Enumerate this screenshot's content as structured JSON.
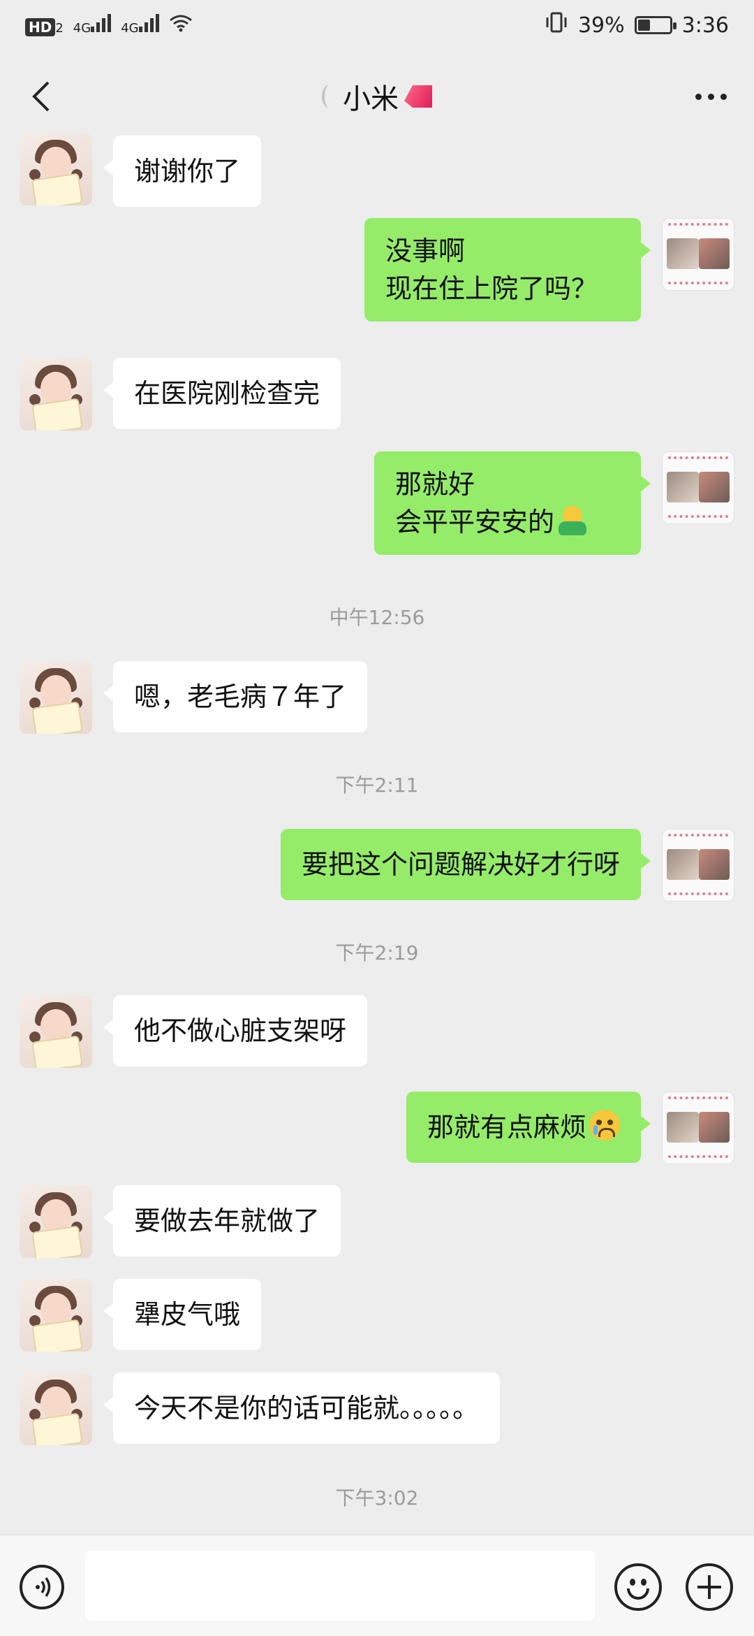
{
  "status_bar": {
    "hd": "HD",
    "hd_sub": "2",
    "net1": "4G",
    "net2": "4G",
    "battery_percent": "39%",
    "battery_level": 0.39,
    "time": "3:36",
    "icons": [
      "hd-icon",
      "signal-icon",
      "signal-icon",
      "wifi-icon",
      "vibrate-icon",
      "battery-icon"
    ]
  },
  "header": {
    "title": "小米",
    "back_icon": "chevron-left-icon",
    "more_icon": "more-dots-icon"
  },
  "messages": [
    {
      "side": "left",
      "lines": [
        "谢谢你了"
      ]
    },
    {
      "side": "right",
      "lines": [
        "没事啊",
        "现在住上院了吗？"
      ]
    },
    {
      "side": "left",
      "lines": [
        "在医院刚检查完"
      ]
    },
    {
      "side": "right",
      "lines": [
        "那就好",
        "会平平安安的"
      ],
      "emoji": "hug-emoji"
    },
    {
      "type": "time",
      "text": "中午12:56"
    },
    {
      "side": "left",
      "lines": [
        "嗯，老毛病７年了"
      ]
    },
    {
      "type": "time",
      "text": "下午2:11"
    },
    {
      "side": "right",
      "lines": [
        "要把这个问题解决好才行呀"
      ]
    },
    {
      "type": "time",
      "text": "下午2:19"
    },
    {
      "side": "left",
      "lines": [
        "他不做心脏支架呀"
      ]
    },
    {
      "side": "right",
      "lines": [
        "那就有点麻烦"
      ],
      "emoji": "crying-emoji"
    },
    {
      "side": "left",
      "lines": [
        "要做去年就做了"
      ]
    },
    {
      "side": "left",
      "lines": [
        "犟皮气哦"
      ]
    },
    {
      "side": "left",
      "lines": [
        "今天不是你的话可能就。。。。。"
      ]
    },
    {
      "type": "time",
      "text": "下午3:02"
    }
  ],
  "input_bar": {
    "placeholder": "",
    "voice_icon": "voice-icon",
    "emoji_icon": "smiley-icon",
    "plus_icon": "plus-icon"
  },
  "colors": {
    "background": "#ededed",
    "bubble_self": "#95ec69",
    "bubble_other": "#ffffff",
    "timestamp": "#9b9b9b"
  }
}
